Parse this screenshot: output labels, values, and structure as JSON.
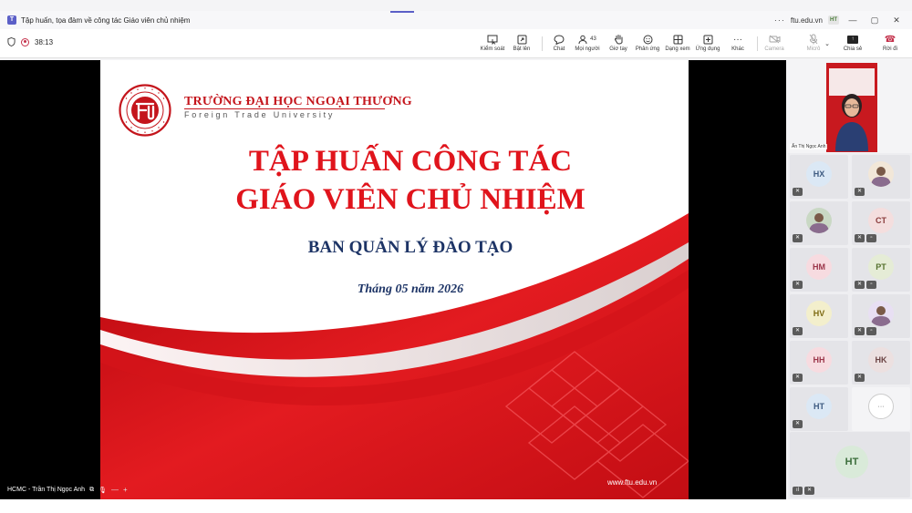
{
  "window": {
    "title": "Tập huấn, tọa đàm về công tác Giáo viên chủ nhiệm",
    "domain": "ftu.edu.vn",
    "user_initials": "HT",
    "more": "···",
    "minimize": "—",
    "maximize": "▢",
    "close": "✕"
  },
  "toolbar": {
    "timer": "38:13",
    "items": [
      {
        "label": "Kiểm soát",
        "icon": "control-icon"
      },
      {
        "label": "Bật lên",
        "icon": "popout-icon"
      },
      {
        "label": "Chat",
        "icon": "chat-icon"
      },
      {
        "label": "Mọi người",
        "icon": "people-icon",
        "count": "43"
      },
      {
        "label": "Giơ tay",
        "icon": "raise-hand-icon"
      },
      {
        "label": "Phản ứng",
        "icon": "reaction-icon"
      },
      {
        "label": "Dạng xem",
        "icon": "view-icon"
      },
      {
        "label": "Ứng dụng",
        "icon": "apps-icon"
      },
      {
        "label": "Khác",
        "icon": "more-icon"
      },
      {
        "label": "Camera",
        "icon": "camera-off-icon"
      },
      {
        "label": "Micrô",
        "icon": "mic-off-icon"
      },
      {
        "label": "Chia sẻ",
        "icon": "share-icon"
      },
      {
        "label": "Rời đi",
        "icon": "leave-call-icon"
      }
    ]
  },
  "slide": {
    "university_vn": "TRƯỜNG ĐẠI HỌC NGOẠI THƯƠNG",
    "university_en": "Foreign Trade University",
    "title_line1": "TẬP HUẤN CÔNG TÁC",
    "title_line2": "GIÁO VIÊN CHỦ NHIỆM",
    "subtitle": "BAN QUẢN LÝ ĐÀO TẠO",
    "date": "Tháng 05 năm 2026",
    "url": "www.ftu.edu.vn",
    "accent_color": "#e0141c",
    "navy_color": "#1d3466"
  },
  "presenter": {
    "name": "HCMC - Trần Thị Ngọc Anh",
    "zoom_out": "—",
    "zoom_in": "+"
  },
  "self_view": {
    "name": "Ấn Thị Ngọc Anh"
  },
  "participants": [
    {
      "initials": "HX",
      "color": "#dbe8f5",
      "text": "#3d5a80"
    },
    {
      "initials": "",
      "color": "#f2e7d8",
      "photo": true
    },
    {
      "initials": "",
      "color": "#c9d8c4",
      "photo": true
    },
    {
      "initials": "CT",
      "color": "#f4dede",
      "text": "#8a3b3b"
    },
    {
      "initials": "HM",
      "color": "#f7dbe0",
      "text": "#9b3549"
    },
    {
      "initials": "PT",
      "color": "#e5ecd6",
      "text": "#55702d"
    },
    {
      "initials": "HV",
      "color": "#f3efcc",
      "text": "#7d6a12"
    },
    {
      "initials": "",
      "color": "#e8dff3",
      "photo": true
    },
    {
      "initials": "HH",
      "color": "#f7dbe0",
      "text": "#9b3549"
    },
    {
      "initials": "HK",
      "color": "#ece0e0",
      "text": "#6b4444"
    },
    {
      "initials": "HT",
      "color": "#dbe8f5",
      "text": "#3d5a80"
    },
    {
      "initials": "···",
      "color": "#ffffff",
      "text": "#555555"
    }
  ],
  "self_tile": {
    "initials": "HT"
  }
}
